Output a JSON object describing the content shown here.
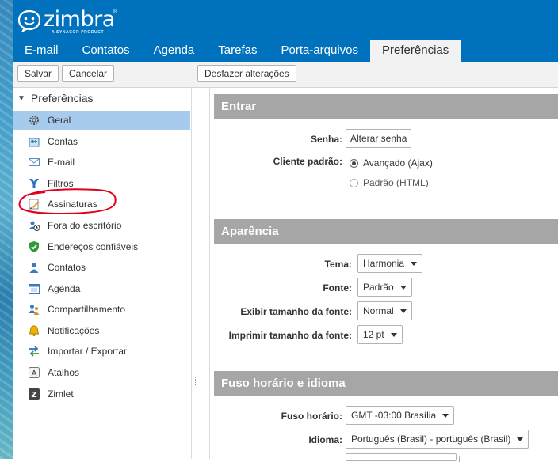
{
  "app": {
    "logo_word": "zimbra",
    "logo_sub": "A SYNACOR PRODUCT",
    "brand_color": "#0071bc"
  },
  "tabs": [
    {
      "label": "E-mail",
      "active": false
    },
    {
      "label": "Contatos",
      "active": false
    },
    {
      "label": "Agenda",
      "active": false
    },
    {
      "label": "Tarefas",
      "active": false
    },
    {
      "label": "Porta-arquivos",
      "active": false
    },
    {
      "label": "Preferências",
      "active": true
    }
  ],
  "toolbar": {
    "save_label": "Salvar",
    "cancel_label": "Cancelar",
    "undo_label": "Desfazer alterações"
  },
  "sidebar": {
    "header": "Preferências",
    "items": [
      {
        "label": "Geral",
        "icon": "gear-icon",
        "selected": true
      },
      {
        "label": "Contas",
        "icon": "accounts-icon",
        "selected": false
      },
      {
        "label": "E-mail",
        "icon": "envelope-icon",
        "selected": false
      },
      {
        "label": "Filtros",
        "icon": "filter-icon",
        "selected": false
      },
      {
        "label": "Assinaturas",
        "icon": "signature-icon",
        "selected": false
      },
      {
        "label": "Fora do escritório",
        "icon": "out-of-office-icon",
        "selected": false
      },
      {
        "label": "Endereços confiáveis",
        "icon": "shield-check-icon",
        "selected": false
      },
      {
        "label": "Contatos",
        "icon": "contact-icon",
        "selected": false
      },
      {
        "label": "Agenda",
        "icon": "calendar-icon",
        "selected": false
      },
      {
        "label": "Compartilhamento",
        "icon": "sharing-icon",
        "selected": false
      },
      {
        "label": "Notificações",
        "icon": "bell-icon",
        "selected": false
      },
      {
        "label": "Importar / Exportar",
        "icon": "import-export-icon",
        "selected": false
      },
      {
        "label": "Atalhos",
        "icon": "shortcuts-icon",
        "selected": false
      },
      {
        "label": "Zimlet",
        "icon": "zimlet-icon",
        "selected": false
      }
    ],
    "selected_color": "#a6cbed",
    "annotation_color": "#e0001b"
  },
  "sections": {
    "login": {
      "title": "Entrar",
      "password_label": "Senha:",
      "change_password_button": "Alterar senha",
      "default_client_label": "Cliente padrão:",
      "client_options": [
        {
          "label": "Avançado (Ajax)",
          "checked": true
        },
        {
          "label": "Padrão (HTML)",
          "checked": false
        }
      ]
    },
    "appearance": {
      "title": "Aparência",
      "theme_label": "Tema:",
      "theme_value": "Harmonia",
      "font_label": "Fonte:",
      "font_value": "Padrão",
      "display_font_size_label": "Exibir tamanho da fonte:",
      "display_font_size_value": "Normal",
      "print_font_size_label": "Imprimir tamanho da fonte:",
      "print_font_size_value": "12 pt"
    },
    "timezone_language": {
      "title": "Fuso horário e idioma",
      "timezone_label": "Fuso horário:",
      "timezone_value": "GMT -03:00 Brasília",
      "language_label": "Idioma:",
      "language_value": "Português (Brasil) - português (Brasil)"
    }
  },
  "section_header_color": "#a6a6a6"
}
